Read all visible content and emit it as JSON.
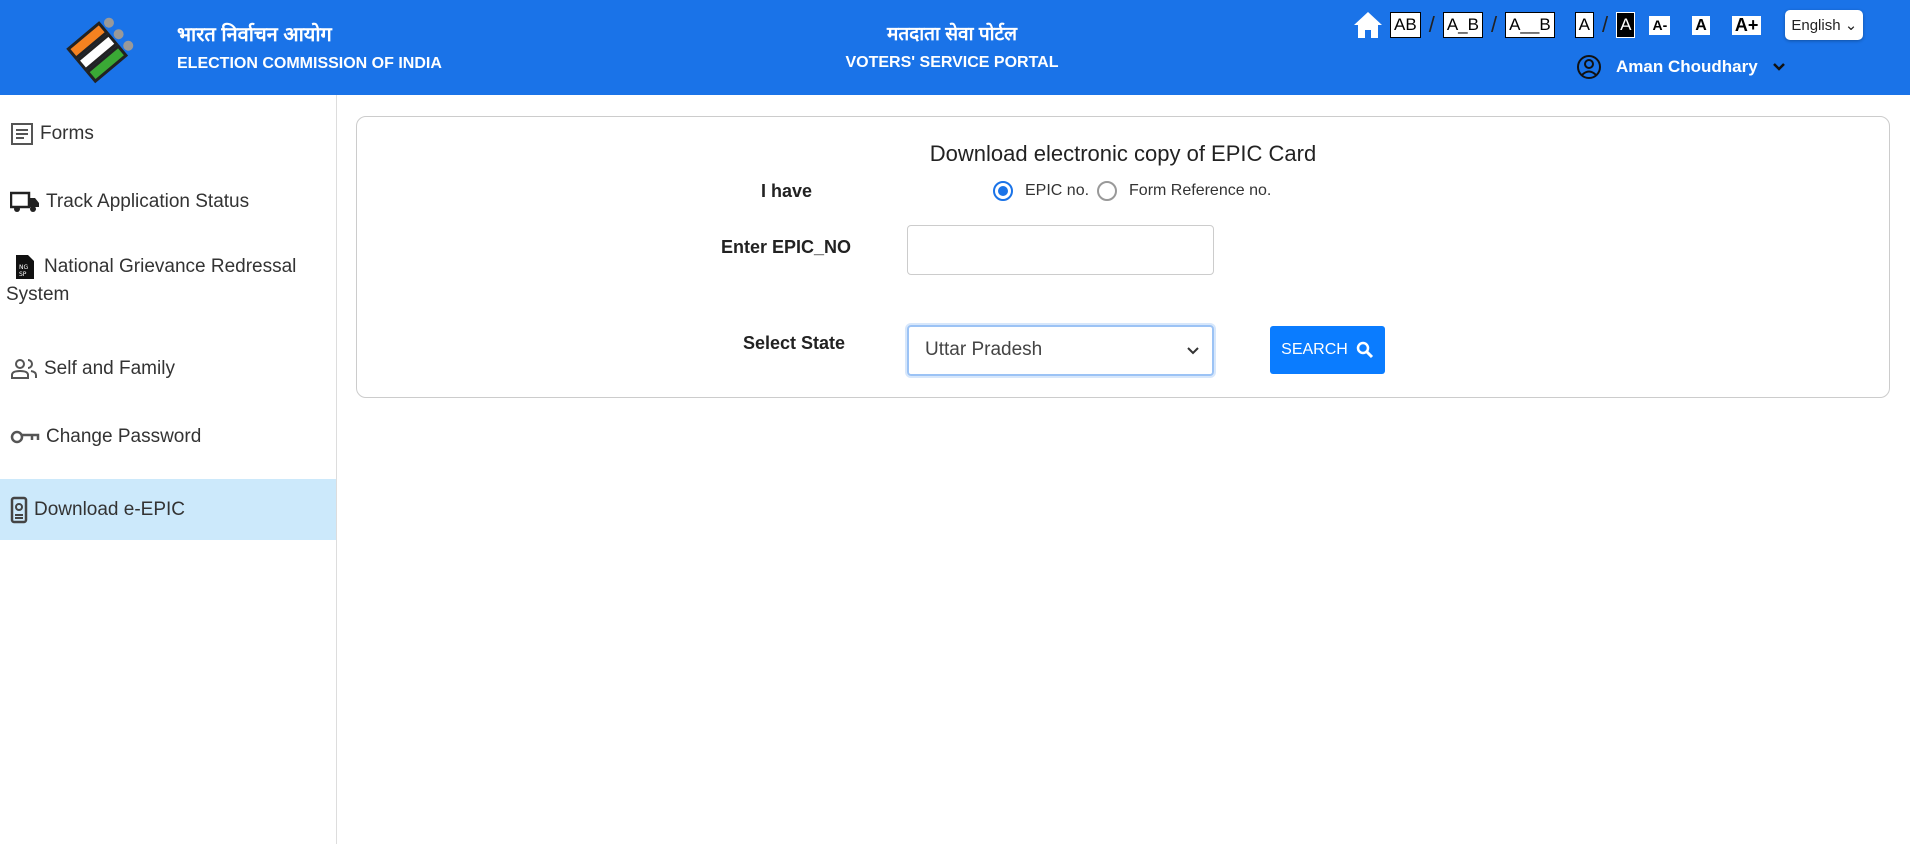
{
  "header": {
    "org_hindi": "भारत निर्वाचन आयोग",
    "org_english": "ELECTION COMMISSION OF INDIA",
    "portal_hindi": "मतदाता सेवा पोर्टल",
    "portal_english": "VOTERS' SERVICE PORTAL",
    "spacing_options": [
      "AB",
      "A_B",
      "A__B"
    ],
    "contrast_options": [
      "A",
      "A"
    ],
    "font_size_options": [
      "A-",
      "A",
      "A+"
    ],
    "language": "English",
    "user_name": "Aman Choudhary",
    "brand_color": "#1a73e8"
  },
  "sidebar": {
    "items": [
      {
        "label": "Forms",
        "icon": "document-icon"
      },
      {
        "label": "Track Application Status",
        "icon": "truck-icon"
      },
      {
        "label": "National Grievance Redressal System",
        "icon": "ngsp-file-icon"
      },
      {
        "label": "Self and Family",
        "icon": "people-icon"
      },
      {
        "label": "Change Password",
        "icon": "key-icon"
      },
      {
        "label": "Download e-EPIC",
        "icon": "id-card-icon",
        "active": true
      }
    ]
  },
  "form": {
    "title": "Download electronic copy of EPIC Card",
    "i_have_label": "I have",
    "radio_options": [
      "EPIC no.",
      "Form Reference no."
    ],
    "selected_option": "EPIC no.",
    "epic_label": "Enter EPIC_NO",
    "epic_value": "",
    "state_label": "Select State",
    "state_value": "Uttar Pradesh",
    "search_label": "SEARCH"
  }
}
